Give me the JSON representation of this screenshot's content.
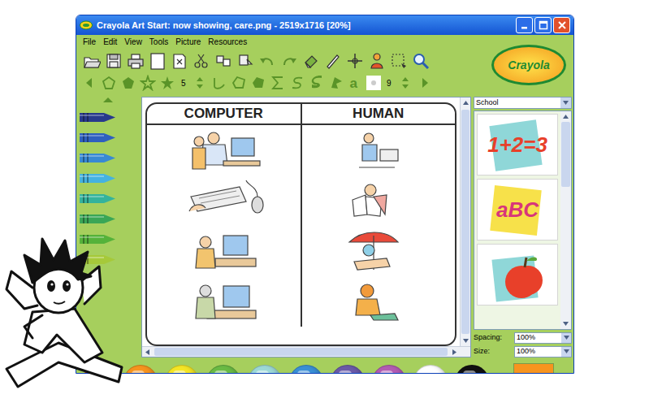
{
  "window": {
    "title": "Crayola Art Start: now showing, care.png - 2519x1716 [20%]"
  },
  "menu": [
    "File",
    "Edit",
    "View",
    "Tools",
    "Picture",
    "Resources"
  ],
  "logo": "Crayola",
  "shapes_bar": {
    "width": "5",
    "size": "9",
    "text_tool": "a"
  },
  "crayons": [
    {
      "color": "#28398c"
    },
    {
      "color": "#2f5fbf"
    },
    {
      "color": "#3889d4"
    },
    {
      "color": "#45b2e0"
    },
    {
      "color": "#34b39c"
    },
    {
      "color": "#3aa656"
    },
    {
      "color": "#55b23a"
    },
    {
      "color": "#a6c93a"
    }
  ],
  "canvas": {
    "columns": [
      "COMPUTER",
      "HUMAN"
    ]
  },
  "resources": {
    "category": "School",
    "thumbnails": [
      {
        "kind": "text",
        "label": "1+2=3"
      },
      {
        "kind": "text",
        "label": "aBC"
      },
      {
        "kind": "apple"
      }
    ],
    "spacing": {
      "label": "Spacing:",
      "value": "100%"
    },
    "size": {
      "label": "Size:",
      "value": "100%"
    }
  },
  "palette": [
    {
      "color": "#e52421"
    },
    {
      "color": "#f7941e"
    },
    {
      "color": "#f5e625"
    },
    {
      "color": "#6abb45"
    },
    {
      "color": "#9dd9d7"
    },
    {
      "color": "#3a8fd6"
    },
    {
      "color": "#6b5aa8"
    },
    {
      "color": "#b35cb3"
    },
    {
      "color": "#ffffff"
    },
    {
      "color": "#111111"
    }
  ],
  "current_color": {
    "color": "#f7941e"
  }
}
